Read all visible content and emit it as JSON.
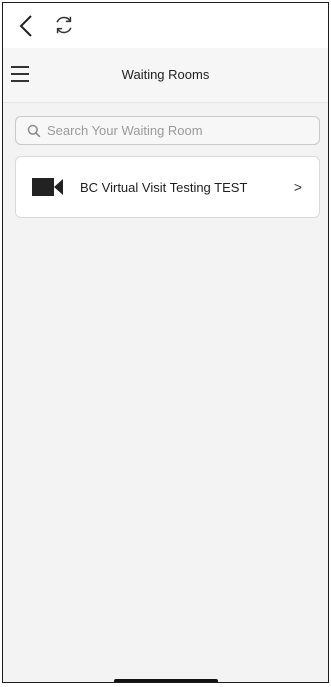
{
  "browser": {
    "back_icon": "chevron-left-icon",
    "reload_icon": "refresh-icon"
  },
  "header": {
    "menu_icon": "hamburger-menu-icon",
    "title": "Waiting Rooms"
  },
  "search": {
    "icon": "search-icon",
    "placeholder": "Search Your Waiting Room",
    "value": ""
  },
  "rooms": [
    {
      "icon": "video-camera-icon",
      "name": "BC Virtual Visit Testing TEST",
      "chevron": ">"
    }
  ],
  "colors": {
    "background": "#f3f3f3",
    "card": "#ffffff",
    "text": "#1e1e1e",
    "placeholder": "#9a9a9a"
  }
}
